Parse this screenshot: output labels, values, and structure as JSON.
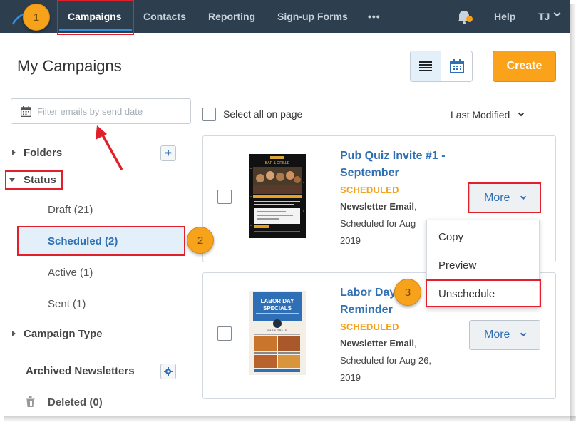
{
  "nav": {
    "items": [
      "Campaigns",
      "Contacts",
      "Reporting",
      "Sign-up Forms"
    ],
    "more_label": "•••",
    "help": "Help",
    "user": "TJ"
  },
  "page": {
    "title": "My Campaigns",
    "create_label": "Create"
  },
  "filter": {
    "placeholder": "Filter emails by send date"
  },
  "list_controls": {
    "select_all": "Select all on page",
    "sort_label": "Last Modified"
  },
  "sidebar": {
    "folders": "Folders",
    "status": "Status",
    "status_items": [
      "Draft (21)",
      "Scheduled (2)",
      "Active (1)",
      "Sent (1)"
    ],
    "campaign_type": "Campaign Type",
    "archived": "Archived Newsletters",
    "deleted": "Deleted (0)"
  },
  "campaigns": [
    {
      "title_line1": "Pub Quiz Invite #1 -",
      "title_line2": "September",
      "status": "SCHEDULED",
      "type": "Newsletter Email",
      "sched_line1": "Scheduled for Aug",
      "sched_line2": "2019",
      "more_label": "More"
    },
    {
      "title_line1": "Labor Day",
      "title_line2": "Reminder",
      "status": "SCHEDULED",
      "type": "Newsletter Email",
      "sched_line1": "Scheduled for Aug 26,",
      "sched_line2": "2019",
      "more_label": "More"
    }
  ],
  "thumbnails": {
    "first": {
      "heading": "BAR & GRILLE"
    },
    "second": {
      "heading_line1": "LABOR DAY",
      "heading_line2": "SPECIALS",
      "logo": "BAR & GRILLE"
    }
  },
  "dropdown_menu": [
    "Copy",
    "Preview",
    "Unschedule"
  ],
  "annotations": [
    "1",
    "2",
    "3"
  ],
  "colors": {
    "nav_bg": "#2d3e4f",
    "accent": "#2f6fb3",
    "create": "#f9a21a",
    "status": "#f2a21f",
    "annotation": "#e0202a"
  }
}
